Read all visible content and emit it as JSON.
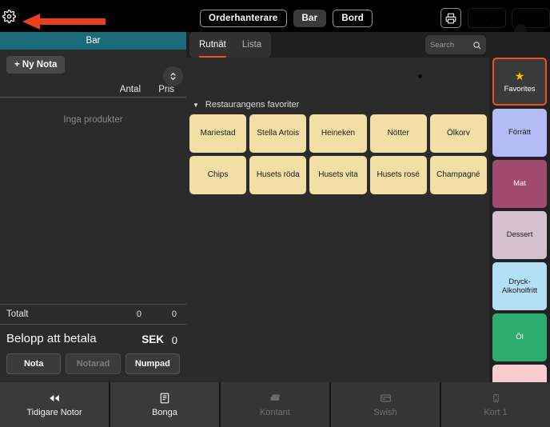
{
  "topbar": {
    "settings_icon": "gear-icon",
    "annotation": "red-left-arrow",
    "nav": [
      {
        "label": "Orderhanterare",
        "active": false
      },
      {
        "label": "Bar",
        "active": true
      },
      {
        "label": "Bord",
        "active": false
      }
    ],
    "print_icon": "printer-icon"
  },
  "order_panel": {
    "header": "Bar",
    "new_note_label": "+ Ny Nota",
    "columns": {
      "qty": "Antal",
      "price": "Pris"
    },
    "stepper_icon": "chevron-up-down-icon",
    "empty_message": "Inga produkter",
    "totals": {
      "label": "Totalt",
      "qty": "0",
      "price": "0"
    },
    "payable": {
      "label": "Belopp att betala",
      "currency": "SEK",
      "amount": "0"
    },
    "buttons": [
      {
        "label": "Nota",
        "disabled": false
      },
      {
        "label": "Notarad",
        "disabled": true
      },
      {
        "label": "Numpad",
        "disabled": false
      }
    ]
  },
  "center": {
    "tabs": [
      {
        "label": "Rutnät",
        "active": true
      },
      {
        "label": "Lista",
        "active": false
      }
    ],
    "search": {
      "placeholder": "Search",
      "value": "",
      "icon": "search-icon"
    },
    "group": {
      "label": "Restaurangens favoriter",
      "caret": "caret-down-icon"
    },
    "products": [
      "Mariestad",
      "Stella Artois",
      "Heineken",
      "Nötter",
      "Ölkorv",
      "Chips",
      "Husets röda",
      "Husets vita",
      "Husets rosé",
      "Champagné"
    ],
    "product_color": "#f2dfa5"
  },
  "categories": [
    {
      "label": "Favorites",
      "color": "#3a3a3a",
      "text_color": "#ffffff",
      "selected": true,
      "icon": "star-icon"
    },
    {
      "label": "Förrätt",
      "color": "#b3bcf5",
      "text_color": "#1c1c1c",
      "selected": false
    },
    {
      "label": "Mat",
      "color": "#a04a6e",
      "text_color": "#ffffff",
      "selected": false
    },
    {
      "label": "Dessert",
      "color": "#d5c0cd",
      "text_color": "#1c1c1c",
      "selected": false
    },
    {
      "label": "Dryck-Alkoholfritt",
      "color": "#b3e0f5",
      "text_color": "#1c1c1c",
      "selected": false
    },
    {
      "label": "Öl",
      "color": "#2bab6e",
      "text_color": "#ffffff",
      "selected": false
    },
    {
      "label": "",
      "color": "#f9ccd2",
      "text_color": "#1c1c1c",
      "selected": false
    }
  ],
  "bottom_bar": [
    {
      "label": "Tidigare Notor",
      "icon": "rewind-icon",
      "disabled": false
    },
    {
      "label": "Bonga",
      "icon": "receipt-icon",
      "disabled": false
    },
    {
      "label": "Kontant",
      "icon": "cash-icon",
      "disabled": true
    },
    {
      "label": "Swish",
      "icon": "card-icon",
      "disabled": true
    },
    {
      "label": "Kort 1",
      "icon": "terminal-icon",
      "disabled": true
    }
  ],
  "colors": {
    "accent": "#e8541f",
    "header_teal": "#1b6a7a",
    "panel_bg": "#2b2b2b",
    "annotation_red": "#e8401f"
  }
}
